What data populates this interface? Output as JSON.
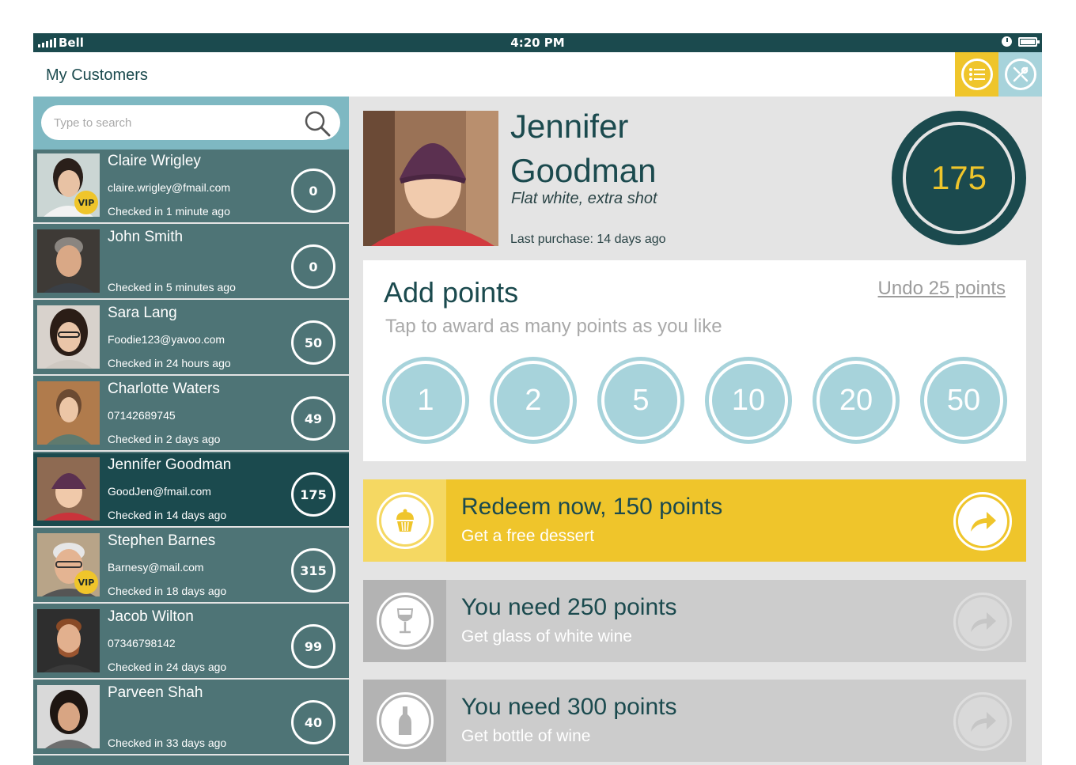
{
  "status_bar": {
    "carrier": "Bell",
    "time": "4:20 PM"
  },
  "header": {
    "title": "My Customers",
    "list_icon": "list-icon",
    "tools_icon": "tools-icon"
  },
  "colors": {
    "dark_teal": "#1b4a4e",
    "teal": "#4e7476",
    "light_blue": "#a7d3db",
    "yellow": "#efc52b",
    "gray": "#cccccc"
  },
  "search": {
    "placeholder": "Type to search"
  },
  "customers": [
    {
      "name": "Claire Wrigley",
      "contact": "claire.wrigley@fmail.com",
      "checked": "Checked in 1 minute ago",
      "points": "0",
      "vip": "VIP"
    },
    {
      "name": "John Smith",
      "contact": "",
      "checked": "Checked in 5 minutes ago",
      "points": "0",
      "vip": ""
    },
    {
      "name": "Sara Lang",
      "contact": "Foodie123@yavoo.com",
      "checked": "Checked in 24 hours ago",
      "points": "50",
      "vip": ""
    },
    {
      "name": "Charlotte Waters",
      "contact": "07142689745",
      "checked": "Checked in 2 days ago",
      "points": "49",
      "vip": ""
    },
    {
      "name": "Jennifer Goodman",
      "contact": "GoodJen@fmail.com",
      "checked": "Checked in 14 days ago",
      "points": "175",
      "vip": "",
      "active": true
    },
    {
      "name": "Stephen Barnes",
      "contact": "Barnesy@mail.com",
      "checked": "Checked in 18 days ago",
      "points": "315",
      "vip": "VIP"
    },
    {
      "name": "Jacob Wilton",
      "contact": "07346798142",
      "checked": "Checked in 24 days ago",
      "points": "99",
      "vip": ""
    },
    {
      "name": "Parveen Shah",
      "contact": "",
      "checked": "Checked in 33 days ago",
      "points": "40",
      "vip": ""
    }
  ],
  "profile": {
    "first_name": "Jennifer",
    "last_name": "Goodman",
    "preference": "Flat white, extra shot",
    "last_purchase": "Last purchase: 14 days ago",
    "points": "175"
  },
  "add_points": {
    "title": "Add points",
    "subtitle": "Tap to award as many points as you like",
    "undo": "Undo 25 points",
    "options": [
      "1",
      "2",
      "5",
      "10",
      "20",
      "50"
    ]
  },
  "rewards": [
    {
      "title": "Redeem now, 150 points",
      "subtitle": "Get a free dessert",
      "icon": "cupcake-icon",
      "state": "available"
    },
    {
      "title": "You need 250 points",
      "subtitle": "Get glass of white wine",
      "icon": "wine-glass-icon",
      "state": "locked"
    },
    {
      "title": "You need 300 points",
      "subtitle": "Get bottle of wine",
      "icon": "wine-bottle-icon",
      "state": "locked"
    }
  ]
}
